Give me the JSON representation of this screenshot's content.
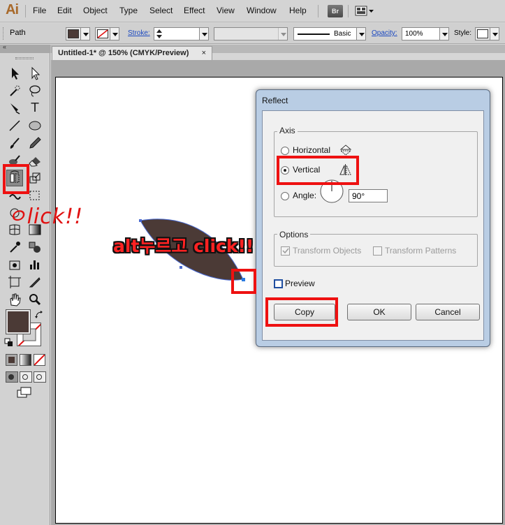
{
  "app": {
    "logo": "Ai"
  },
  "menu": [
    "File",
    "Edit",
    "Object",
    "Type",
    "Select",
    "Effect",
    "View",
    "Window",
    "Help"
  ],
  "bridge_label": "Br",
  "control": {
    "selection_label": "Path",
    "stroke_label": "Stroke:",
    "brush_style": "Basic",
    "opacity_label": "Opacity:",
    "opacity_value": "100%",
    "style_label": "Style:"
  },
  "document": {
    "tab_title": "Untitled-1* @ 150% (CMYK/Preview)",
    "close": "×"
  },
  "toolbox": {
    "collapse": "«"
  },
  "colors": {
    "fill": "#4b3a36",
    "annotation": "#e01010",
    "accent": "#1a48c0"
  },
  "dialog": {
    "title": "Reflect",
    "axis_group": "Axis",
    "horizontal_label": "Horizontal",
    "vertical_label": "Vertical",
    "angle_label": "Angle:",
    "angle_value": "90°",
    "selected_axis": "Vertical",
    "options_group": "Options",
    "transform_objects": "Transform Objects",
    "transform_patterns": "Transform Patterns",
    "preview_label": "Preview",
    "copy_button": "Copy",
    "ok_button": "OK",
    "cancel_button": "Cancel"
  },
  "annotations": {
    "tool_click": "ㅇlick!!",
    "alt_click": "alt누르고 click!!"
  }
}
